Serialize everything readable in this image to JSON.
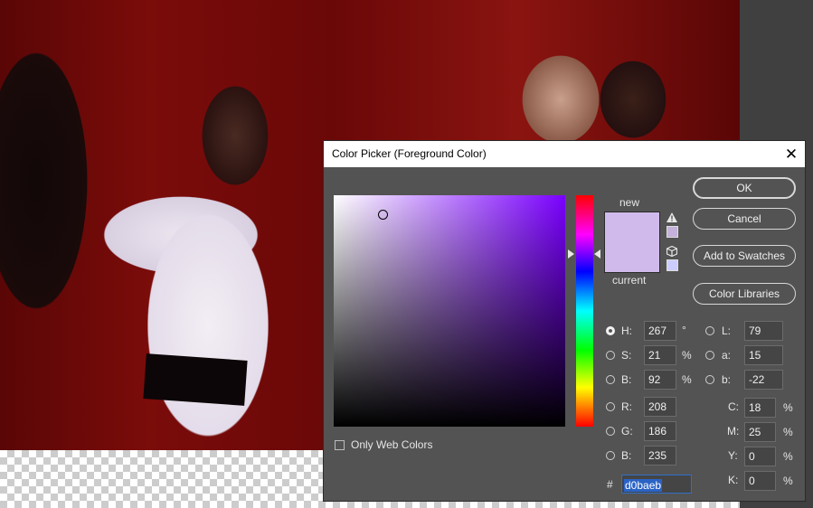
{
  "dialog": {
    "title": "Color Picker (Foreground Color)",
    "close_glyph": "✕"
  },
  "preview": {
    "new_label": "new",
    "current_label": "current",
    "new_color": "#d0baeb",
    "warning_icon": "alert-triangle-icon",
    "websafe_icon": "cube-icon"
  },
  "buttons": {
    "ok": "OK",
    "cancel": "Cancel",
    "add_to_swatches": "Add to Swatches",
    "color_libraries": "Color Libraries"
  },
  "hsb": [
    {
      "key": "H",
      "label": "H:",
      "value": "267",
      "unit": "°",
      "selected": true
    },
    {
      "key": "S",
      "label": "S:",
      "value": "21",
      "unit": "%",
      "selected": false
    },
    {
      "key": "B",
      "label": "B:",
      "value": "92",
      "unit": "%",
      "selected": false
    }
  ],
  "rgb": [
    {
      "key": "R",
      "label": "R:",
      "value": "208"
    },
    {
      "key": "G",
      "label": "G:",
      "value": "186"
    },
    {
      "key": "B",
      "label": "B:",
      "value": "235"
    }
  ],
  "lab": [
    {
      "key": "L",
      "label": "L:",
      "value": "79"
    },
    {
      "key": "a",
      "label": "a:",
      "value": "15"
    },
    {
      "key": "b",
      "label": "b:",
      "value": "-22"
    }
  ],
  "cmyk": [
    {
      "key": "C",
      "label": "C:",
      "value": "18",
      "unit": "%"
    },
    {
      "key": "M",
      "label": "M:",
      "value": "25",
      "unit": "%"
    },
    {
      "key": "Y",
      "label": "Y:",
      "value": "0",
      "unit": "%"
    },
    {
      "key": "K",
      "label": "K:",
      "value": "0",
      "unit": "%"
    }
  ],
  "web_colors": {
    "label": "Only Web Colors",
    "checked": false
  },
  "hex": {
    "prefix": "#",
    "value": "d0baeb"
  }
}
